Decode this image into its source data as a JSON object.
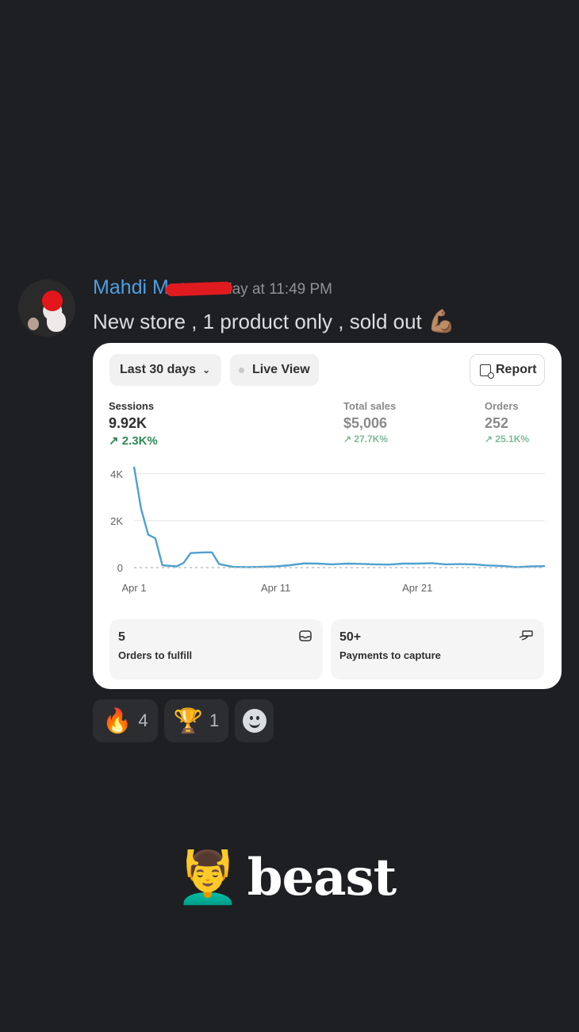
{
  "message": {
    "username": "Mahdi M",
    "timestamp": "Yesterday at 11:49 PM",
    "text": "New store , 1 product only , sold out",
    "text_emoji": "💪🏽"
  },
  "card": {
    "range_button": "Last 30 days",
    "live_button": "Live View",
    "report_button": "Report",
    "metrics": [
      {
        "label": "Sessions",
        "value": "9.92K",
        "change": "↗ 2.3K%"
      },
      {
        "label": "Total sales",
        "value": "$5,006",
        "change": "↗ 27.7K%"
      },
      {
        "label": "Orders",
        "value": "252",
        "change": "↗ 25.1K%"
      }
    ],
    "tiles": [
      {
        "value": "5",
        "label": "Orders to fulfill",
        "icon": "inbox-icon"
      },
      {
        "value": "50+",
        "label": "Payments to capture",
        "icon": "hand-payment-icon"
      }
    ]
  },
  "chart_data": {
    "type": "line",
    "title": "",
    "xlabel": "",
    "ylabel": "",
    "ylim": [
      0,
      4500
    ],
    "xlim": [
      1,
      30
    ],
    "y_ticks": [
      "4K",
      "2K",
      "0"
    ],
    "x_ticks": [
      "Apr 1",
      "Apr 11",
      "Apr 21"
    ],
    "grid": true,
    "series": [
      {
        "color": "#4ea1cf",
        "x": [
          1,
          1.5,
          2,
          2.5,
          3,
          4,
          4.5,
          5,
          6,
          6.5,
          7,
          8,
          9,
          10,
          11,
          12,
          13,
          14,
          15,
          16,
          17,
          18,
          19,
          20,
          21,
          22,
          23,
          24,
          25,
          26,
          27,
          28,
          29,
          30
        ],
        "y": [
          4300,
          2500,
          1400,
          1250,
          100,
          50,
          200,
          620,
          650,
          650,
          150,
          30,
          20,
          30,
          50,
          100,
          180,
          170,
          140,
          170,
          160,
          140,
          130,
          170,
          170,
          190,
          140,
          150,
          140,
          90,
          70,
          20,
          50,
          60
        ]
      },
      {
        "color": "#bdbdbd",
        "dashed": true,
        "x": [
          1,
          30
        ],
        "y": [
          0,
          0
        ]
      }
    ]
  },
  "reactions": [
    {
      "emoji": "🔥",
      "count": "4"
    },
    {
      "emoji": "🏆",
      "count": "1"
    }
  ],
  "sticker": {
    "emoji": "💆‍♂️",
    "word": "beast"
  }
}
